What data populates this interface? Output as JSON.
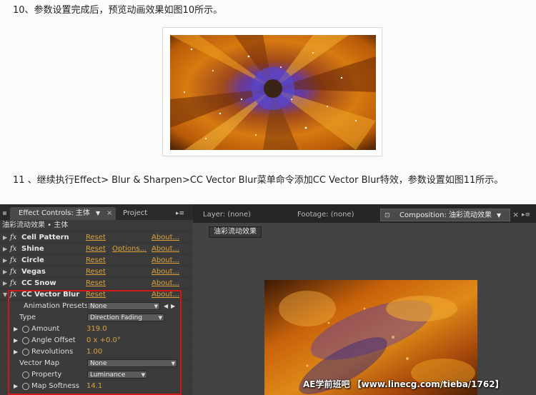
{
  "doc": {
    "para1": "10、参数设置完成后，预览动画效果如图10所示。",
    "para2": "11 、继续执行Effect> Blur & Sharpen>CC Vector Blur菜单命令添加CC Vector Blur特效，参数设置如图11所示。"
  },
  "effect_controls": {
    "tab_label": "Effect Controls: 主体",
    "tab2_label": "Project",
    "subheader": "油彩流动效果 • 主体",
    "effects": [
      {
        "name": "Cell Pattern",
        "reset": "Reset",
        "options": "",
        "about": "About..."
      },
      {
        "name": "Shine",
        "reset": "Reset",
        "options": "Options...",
        "about": "About..."
      },
      {
        "name": "Circle",
        "reset": "Reset",
        "options": "",
        "about": "About..."
      },
      {
        "name": "Vegas",
        "reset": "Reset",
        "options": "",
        "about": "About..."
      },
      {
        "name": "CC Snow",
        "reset": "Reset",
        "options": "",
        "about": "About..."
      },
      {
        "name": "CC Vector Blur",
        "reset": "Reset",
        "options": "",
        "about": "About..."
      }
    ],
    "props": {
      "presets_label": "Animation Presets:",
      "presets_value": "None",
      "type_label": "Type",
      "type_value": "Direction Fading",
      "amount_label": "Amount",
      "amount_value": "319.0",
      "angle_label": "Angle Offset",
      "angle_value": "0 x +0.0°",
      "rev_label": "Revolutions",
      "rev_value": "1.00",
      "vmap_label": "Vector Map",
      "vmap_value": "None",
      "property_label": "Property",
      "property_value": "Luminance",
      "softness_label": "Map Softness",
      "softness_value": "14.1"
    }
  },
  "viewer": {
    "layer_tab": "Layer: (none)",
    "footage_tab": "Footage: (none)",
    "comp_tab": "Composition: 油彩流动效果",
    "comp_button": "油彩流动效果",
    "watermark": "AE学前班吧 【www.linecg.com/tieba/1762】"
  },
  "colors": {
    "accent_link": "#d9a23b",
    "highlight_box": "#d01818"
  }
}
